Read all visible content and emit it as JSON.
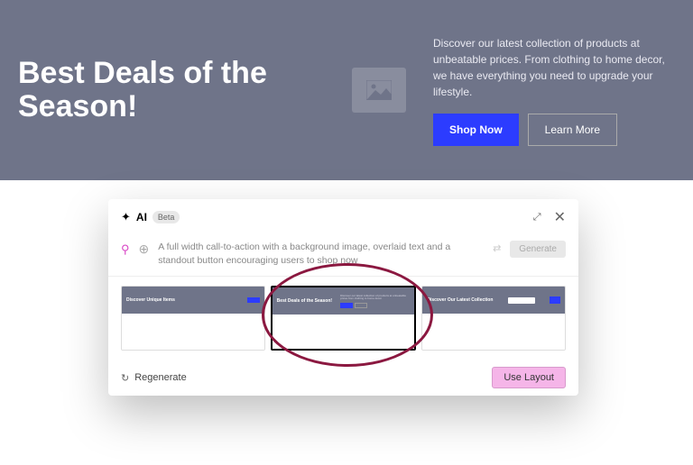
{
  "hero": {
    "title": "Best Deals of the Season!",
    "description": "Discover our latest collection of products at unbeatable prices. From clothing to home decor, we have everything you need to upgrade your lifestyle.",
    "shop_btn": "Shop Now",
    "learn_btn": "Learn More"
  },
  "modal": {
    "ai_label": "AI",
    "beta_label": "Beta",
    "prompt": "A full width call-to-action with a background image, overlaid text and a standout button encouraging users to shop now",
    "generate_btn": "Generate",
    "regenerate_label": "Regenerate",
    "use_layout_btn": "Use Layout",
    "thumbs": [
      {
        "title": "Discover Unique Items",
        "selected": false
      },
      {
        "title": "Best Deals of the Season!",
        "selected": true
      },
      {
        "title": "Discover Our Latest Collection",
        "selected": false
      }
    ]
  }
}
